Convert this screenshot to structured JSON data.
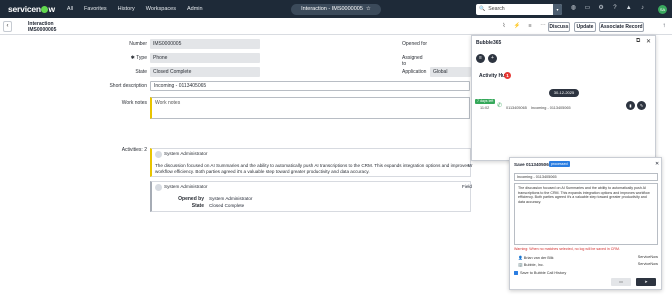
{
  "nav": {
    "logo": "servicenow",
    "menu": [
      "All",
      "Favorites",
      "History",
      "Workspaces",
      "Admin"
    ],
    "pill_title": "Interaction - IMS0000005",
    "search_placeholder": "Search",
    "avatar_initials": "SA"
  },
  "header": {
    "title_line1": "Interaction",
    "title_line2": "IMS0000005",
    "buttons": {
      "discuss": "Discuss",
      "update": "Update",
      "associate": "Associate Record"
    }
  },
  "form": {
    "number_label": "Number",
    "number_value": "IMS0000005",
    "type_label": "Type",
    "type_value": "Phone",
    "state_label": "State",
    "state_value": "Closed Complete",
    "short_desc_label": "Short description",
    "short_desc_value": "Incoming - 0113405065",
    "work_notes_label": "Work notes",
    "work_notes_placeholder": "Work notes",
    "opened_for_label": "Opened for",
    "assigned_to_label": "Assigned to",
    "application_label": "Application",
    "application_value": "Global",
    "activities_label": "Activities: 2"
  },
  "activities": [
    {
      "user": "System Administrator",
      "body": "The discussion focused on AI Summaries and the ability to automatically push AI transcriptions to the CRM. This expands integration options and improves workflow efficiency. Both parties agreed it's a valuable step toward greater productivity and data accuracy.",
      "right_mark": "W"
    },
    {
      "user": "System Administrator",
      "right_mark": "Field",
      "opened_by_label": "Opened by",
      "opened_by_value": "System Administrator",
      "state_label": "State",
      "state_value": "Closed Complete"
    }
  ],
  "bubble": {
    "title": "Bubble365",
    "hub_label": "Activity Hub",
    "hub_count": "1",
    "date_chip": "30-12-2025",
    "call": {
      "tag": "7 days left",
      "time": "11:02",
      "number": "0113405065",
      "label": "Incoming - 0113405065"
    }
  },
  "save_modal": {
    "title": "Save 0113405065",
    "badge": "processed",
    "incoming": "Incoming - 0113405065",
    "summary": "The discussion focused on AI Summaries and the ability to automatically push AI transcriptions to the CRM. This expands integration options and improves workflow efficiency. Both parties agreed it's a valuable step toward greater productivity and data accuracy.",
    "warning": "Warning: When no matches selected, no log will be saved in CRM.",
    "rows": [
      {
        "name": "Brian van der Blik",
        "source": "ServiceNow"
      },
      {
        "name": "Bubble, Inc.",
        "source": "ServiceNow"
      }
    ],
    "save_checkbox_label": "Save to Bubble Call History"
  },
  "colors": {
    "nav_bg": "#1e2a38",
    "accent_green": "#62d84e",
    "notes_bar": "#e8c400",
    "badge_blue": "#2a7de1",
    "warning_red": "#d32f2f"
  }
}
